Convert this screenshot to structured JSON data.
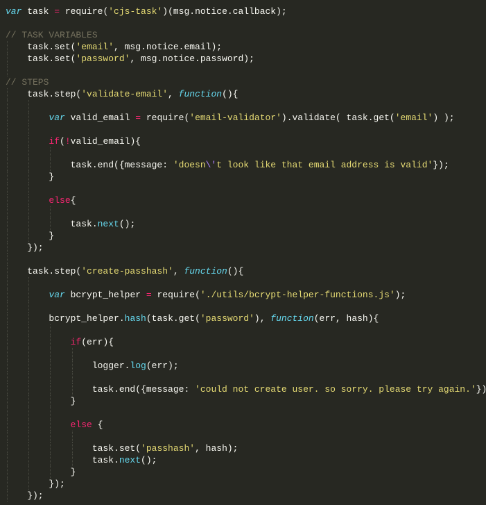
{
  "colors": {
    "background": "#272822",
    "text": "#f8f8f2",
    "keyword": "#f92672",
    "string": "#e6db74",
    "storage": "#66d9ef",
    "comment": "#75715e",
    "escape": "#ae81ff"
  },
  "lines": [
    {
      "tokens": [
        {
          "c": "st",
          "t": "var"
        },
        {
          "c": "p",
          "t": " task "
        },
        {
          "c": "k",
          "t": "="
        },
        {
          "c": "p",
          "t": " require("
        },
        {
          "c": "s",
          "t": "'cjs-task'"
        },
        {
          "c": "p",
          "t": ")(msg.notice.callback);"
        }
      ]
    },
    {
      "tokens": []
    },
    {
      "tokens": [
        {
          "c": "c",
          "t": "// TASK VARIABLES"
        }
      ]
    },
    {
      "tokens": [
        {
          "c": "p",
          "t": "    task.set("
        },
        {
          "c": "s",
          "t": "'email'"
        },
        {
          "c": "p",
          "t": ", msg.notice.email);"
        }
      ]
    },
    {
      "tokens": [
        {
          "c": "p",
          "t": "    task.set("
        },
        {
          "c": "s",
          "t": "'password'"
        },
        {
          "c": "p",
          "t": ", msg.notice.password);"
        }
      ]
    },
    {
      "tokens": []
    },
    {
      "tokens": [
        {
          "c": "c",
          "t": "// STEPS"
        }
      ]
    },
    {
      "tokens": [
        {
          "c": "p",
          "t": "    task.step("
        },
        {
          "c": "s",
          "t": "'validate-email'"
        },
        {
          "c": "p",
          "t": ", "
        },
        {
          "c": "st",
          "t": "function"
        },
        {
          "c": "p",
          "t": "(){"
        }
      ]
    },
    {
      "tokens": []
    },
    {
      "tokens": [
        {
          "c": "p",
          "t": "        "
        },
        {
          "c": "st",
          "t": "var"
        },
        {
          "c": "p",
          "t": " valid_email "
        },
        {
          "c": "k",
          "t": "="
        },
        {
          "c": "p",
          "t": " require("
        },
        {
          "c": "s",
          "t": "'email-validator'"
        },
        {
          "c": "p",
          "t": ").validate( task.get("
        },
        {
          "c": "s",
          "t": "'email'"
        },
        {
          "c": "p",
          "t": ") );"
        }
      ]
    },
    {
      "tokens": []
    },
    {
      "tokens": [
        {
          "c": "p",
          "t": "        "
        },
        {
          "c": "k",
          "t": "if"
        },
        {
          "c": "p",
          "t": "("
        },
        {
          "c": "k",
          "t": "!"
        },
        {
          "c": "p",
          "t": "valid_email){"
        }
      ]
    },
    {
      "tokens": []
    },
    {
      "tokens": [
        {
          "c": "p",
          "t": "            task.end({message: "
        },
        {
          "c": "s",
          "t": "'doesn"
        },
        {
          "c": "e",
          "t": "\\'"
        },
        {
          "c": "s",
          "t": "t look like that email address is valid'"
        },
        {
          "c": "p",
          "t": "});"
        }
      ]
    },
    {
      "tokens": [
        {
          "c": "p",
          "t": "        }"
        }
      ]
    },
    {
      "tokens": []
    },
    {
      "tokens": [
        {
          "c": "p",
          "t": "        "
        },
        {
          "c": "k",
          "t": "else"
        },
        {
          "c": "p",
          "t": "{"
        }
      ]
    },
    {
      "tokens": []
    },
    {
      "tokens": [
        {
          "c": "p",
          "t": "            task."
        },
        {
          "c": "f",
          "t": "next"
        },
        {
          "c": "p",
          "t": "();"
        }
      ]
    },
    {
      "tokens": [
        {
          "c": "p",
          "t": "        }"
        }
      ]
    },
    {
      "tokens": [
        {
          "c": "p",
          "t": "    });"
        }
      ]
    },
    {
      "tokens": []
    },
    {
      "tokens": [
        {
          "c": "p",
          "t": "    task.step("
        },
        {
          "c": "s",
          "t": "'create-passhash'"
        },
        {
          "c": "p",
          "t": ", "
        },
        {
          "c": "st",
          "t": "function"
        },
        {
          "c": "p",
          "t": "(){"
        }
      ]
    },
    {
      "tokens": []
    },
    {
      "tokens": [
        {
          "c": "p",
          "t": "        "
        },
        {
          "c": "st",
          "t": "var"
        },
        {
          "c": "p",
          "t": " bcrypt_helper "
        },
        {
          "c": "k",
          "t": "="
        },
        {
          "c": "p",
          "t": " require("
        },
        {
          "c": "s",
          "t": "'./utils/bcrypt-helper-functions.js'"
        },
        {
          "c": "p",
          "t": ");"
        }
      ]
    },
    {
      "tokens": []
    },
    {
      "tokens": [
        {
          "c": "p",
          "t": "        bcrypt_helper."
        },
        {
          "c": "f",
          "t": "hash"
        },
        {
          "c": "p",
          "t": "(task.get("
        },
        {
          "c": "s",
          "t": "'password'"
        },
        {
          "c": "p",
          "t": "), "
        },
        {
          "c": "st",
          "t": "function"
        },
        {
          "c": "p",
          "t": "(err, hash){"
        }
      ]
    },
    {
      "tokens": []
    },
    {
      "tokens": [
        {
          "c": "p",
          "t": "            "
        },
        {
          "c": "k",
          "t": "if"
        },
        {
          "c": "p",
          "t": "(err){"
        }
      ]
    },
    {
      "tokens": []
    },
    {
      "tokens": [
        {
          "c": "p",
          "t": "                logger."
        },
        {
          "c": "f",
          "t": "log"
        },
        {
          "c": "p",
          "t": "(err);"
        }
      ]
    },
    {
      "tokens": []
    },
    {
      "tokens": [
        {
          "c": "p",
          "t": "                task.end({message: "
        },
        {
          "c": "s",
          "t": "'could not create user. so sorry. please try again.'"
        },
        {
          "c": "p",
          "t": "});"
        }
      ]
    },
    {
      "tokens": [
        {
          "c": "p",
          "t": "            }"
        }
      ]
    },
    {
      "tokens": []
    },
    {
      "tokens": [
        {
          "c": "p",
          "t": "            "
        },
        {
          "c": "k",
          "t": "else"
        },
        {
          "c": "p",
          "t": " {"
        }
      ]
    },
    {
      "tokens": []
    },
    {
      "tokens": [
        {
          "c": "p",
          "t": "                task.set("
        },
        {
          "c": "s",
          "t": "'passhash'"
        },
        {
          "c": "p",
          "t": ", hash);"
        }
      ]
    },
    {
      "tokens": [
        {
          "c": "p",
          "t": "                task."
        },
        {
          "c": "f",
          "t": "next"
        },
        {
          "c": "p",
          "t": "();"
        }
      ]
    },
    {
      "tokens": [
        {
          "c": "p",
          "t": "            }"
        }
      ]
    },
    {
      "tokens": [
        {
          "c": "p",
          "t": "        });"
        }
      ]
    },
    {
      "tokens": [
        {
          "c": "p",
          "t": "    });"
        }
      ]
    }
  ]
}
